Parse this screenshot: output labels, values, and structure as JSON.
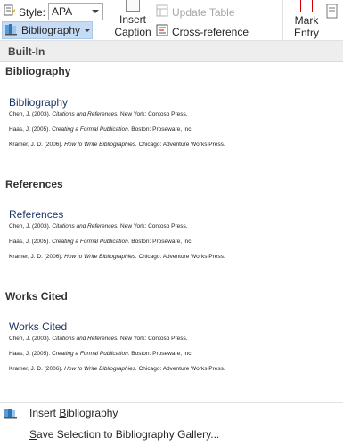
{
  "ribbon": {
    "style_label": "Style:",
    "style_value": "APA",
    "bibliography_label": "Bibliography",
    "insert_caption_line1": "Insert",
    "insert_caption_line2": "Caption",
    "update_table_label": "Update Table",
    "cross_reference_label": "Cross-reference",
    "mark_entry_line1": "Mark",
    "mark_entry_line2": "Entry"
  },
  "gallery": {
    "section_label": "Built-In",
    "entries": [
      {
        "heading": "Bibliography",
        "preview_title": "Bibliography",
        "citations": [
          {
            "lead": "Chen, J. (2003). ",
            "title": "Citations and References.",
            "tail": " New York: Contoso Press."
          },
          {
            "lead": "Haas, J. (2005). ",
            "title": "Creating a Formal Publication.",
            "tail": " Boston: Proseware, Inc."
          },
          {
            "lead": "Kramer, J. D. (2006). ",
            "title": "How to Write Bibliographies.",
            "tail": " Chicago: Adventure Works Press."
          }
        ]
      },
      {
        "heading": "References",
        "preview_title": "References",
        "citations": [
          {
            "lead": "Chen, J. (2003). ",
            "title": "Citations and References.",
            "tail": " New York: Contoso Press."
          },
          {
            "lead": "Haas, J. (2005). ",
            "title": "Creating a Formal Publication.",
            "tail": " Boston: Proseware, Inc."
          },
          {
            "lead": "Kramer, J. D. (2006). ",
            "title": "How to Write Bibliographies.",
            "tail": " Chicago: Adventure Works Press."
          }
        ]
      },
      {
        "heading": "Works Cited",
        "preview_title": "Works Cited",
        "citations": [
          {
            "lead": "Chen, J. (2003). ",
            "title": "Citations and References.",
            "tail": " New York: Contoso Press."
          },
          {
            "lead": "Haas, J. (2005). ",
            "title": "Creating a Formal Publication.",
            "tail": " Boston: Proseware, Inc."
          },
          {
            "lead": "Kramer, J. D. (2006). ",
            "title": "How to Write Bibliographies.",
            "tail": " Chicago: Adventure Works Press."
          }
        ]
      }
    ],
    "menu": {
      "insert_bibliography_pre": "Insert ",
      "insert_bibliography_key": "B",
      "insert_bibliography_post": "ibliography",
      "save_selection_key": "S",
      "save_selection_post": "ave Selection to Bibliography Gallery..."
    }
  },
  "colors": {
    "accent_button_bg": "#c5dcf4",
    "preview_title": "#1f3864",
    "section_bar": "#eeeeee"
  }
}
